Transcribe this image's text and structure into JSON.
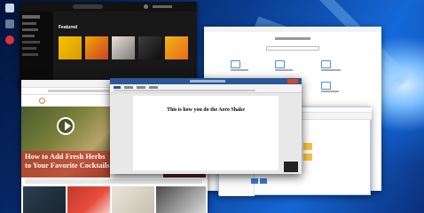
{
  "word": {
    "doc_text": "This is how you do the Aero Shake"
  },
  "browser": {
    "article_title": "How to Add Fresh Herbs to Your Favorite Cocktails"
  },
  "spotify": {
    "section_title": "Featured"
  },
  "icons": {
    "recycle": "recycle-bin-icon",
    "app1": "app-icon",
    "app2": "app-icon",
    "windows": "windows-logo-icon"
  },
  "colors": {
    "word_accent": "#2b5797",
    "browser_overlay": "#c0392b",
    "spotify_bg": "#181818",
    "desktop_blue": "#1567d6"
  }
}
